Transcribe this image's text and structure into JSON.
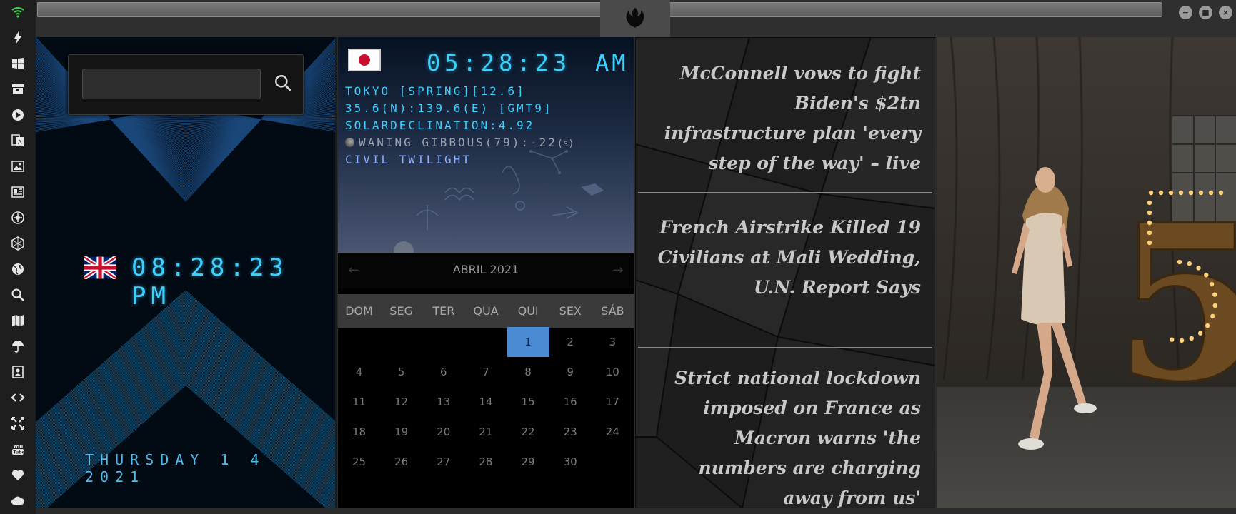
{
  "sidebar": {
    "items": [
      {
        "icon": "wifi-icon"
      },
      {
        "icon": "lightning-icon"
      },
      {
        "icon": "windows-icon"
      },
      {
        "icon": "archive-icon"
      },
      {
        "icon": "play-icon"
      },
      {
        "icon": "translate-icon"
      },
      {
        "icon": "image-icon"
      },
      {
        "icon": "newspaper-icon"
      },
      {
        "icon": "sun-icon"
      },
      {
        "icon": "hexagon-icon"
      },
      {
        "icon": "globe-icon"
      },
      {
        "icon": "search-icon"
      },
      {
        "icon": "map-icon"
      },
      {
        "icon": "umbrella-icon"
      },
      {
        "icon": "contacts-icon"
      },
      {
        "icon": "code-icon"
      },
      {
        "icon": "fullscreen-icon"
      },
      {
        "icon": "youtube-icon"
      },
      {
        "icon": "heart-icon"
      },
      {
        "icon": "cloud-icon"
      }
    ]
  },
  "titlebar": {
    "logo_icon": "rebel-alliance-icon",
    "controls": [
      "minimize-icon",
      "maximize-icon",
      "close-icon"
    ]
  },
  "clock_uk": {
    "search_placeholder": "",
    "time": "08:28:23 PM",
    "date": "THURSDAY 1 4 2021",
    "flag": "uk-flag-icon"
  },
  "clock_jp": {
    "time": "05:28:23",
    "ampm": "AM",
    "flag": "japan-flag-icon",
    "city_line": "TOKYO [SPRING][12.6]",
    "coord_line": "35.6(N):139.6(E) [GMT9]",
    "solar_line": "SOLARDECLINATION:4.92",
    "moon_line": "WANING GIBBOUS(79):-22",
    "moon_suffix": "(s)",
    "twilight": "CIVIL TWILIGHT",
    "colors": {
      "accent": "#3ad1ff",
      "moon_text": "#9aa3b0",
      "twilight": "#8ab0ff",
      "city_value": "#ffe066"
    }
  },
  "calendar": {
    "month_label": "ABRIL 2021",
    "weekdays": [
      "DOM",
      "SEG",
      "TER",
      "QUA",
      "QUI",
      "SEX",
      "SÁB"
    ],
    "weeks": [
      [
        "",
        "",
        "",
        "",
        "1",
        "2",
        "3"
      ],
      [
        "4",
        "5",
        "6",
        "7",
        "8",
        "9",
        "10"
      ],
      [
        "11",
        "12",
        "13",
        "14",
        "15",
        "16",
        "17"
      ],
      [
        "18",
        "19",
        "20",
        "21",
        "22",
        "23",
        "24"
      ],
      [
        "25",
        "26",
        "27",
        "28",
        "29",
        "30",
        ""
      ]
    ],
    "today": "1",
    "today_color": "#4a8bd4"
  },
  "news": {
    "headlines": [
      "McConnell vows to fight Biden's $2tn infrastructure plan 'every step of the way' – live",
      "French Airstrike Killed 19 Civilians at Mali Wedding, U.N. Report Says",
      "Strict national lockdown imposed on France as Macron warns 'the numbers are charging away from us'"
    ]
  },
  "photo": {
    "numeral": "5"
  }
}
